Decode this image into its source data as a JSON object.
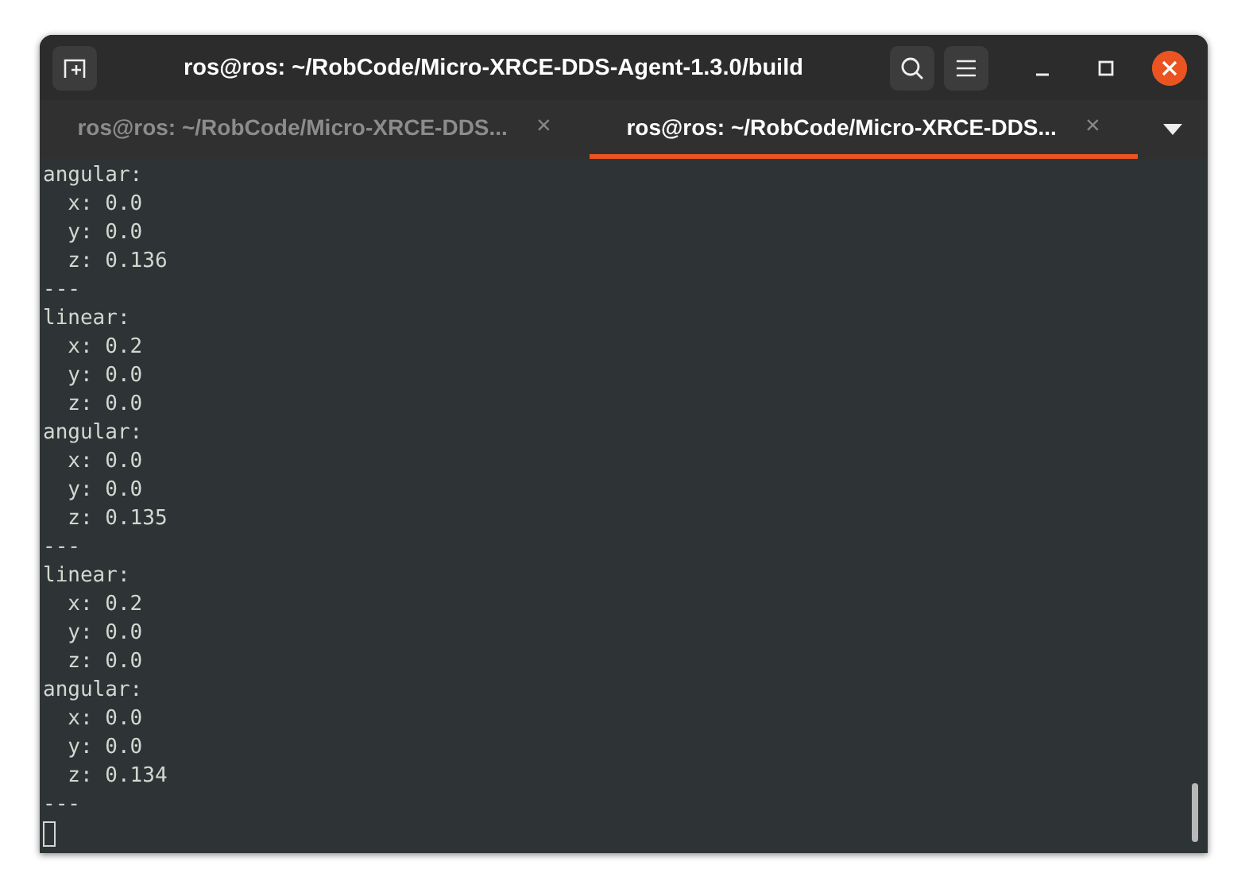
{
  "window": {
    "title": "ros@ros: ~/RobCode/Micro-XRCE-DDS-Agent-1.3.0/build"
  },
  "tabs": [
    {
      "label": "ros@ros: ~/RobCode/Micro-XRCE-DDS...",
      "close": "×",
      "selected": false
    },
    {
      "label": "ros@ros: ~/RobCode/Micro-XRCE-DDS...",
      "close": "×",
      "selected": true
    }
  ],
  "terminal": {
    "lines": [
      "angular:",
      "  x: 0.0",
      "  y: 0.0",
      "  z: 0.136",
      "---",
      "linear:",
      "  x: 0.2",
      "  y: 0.0",
      "  z: 0.0",
      "angular:",
      "  x: 0.0",
      "  y: 0.0",
      "  z: 0.135",
      "---",
      "linear:",
      "  x: 0.2",
      "  y: 0.0",
      "  z: 0.0",
      "angular:",
      "  x: 0.0",
      "  y: 0.0",
      "  z: 0.134",
      "---"
    ]
  }
}
